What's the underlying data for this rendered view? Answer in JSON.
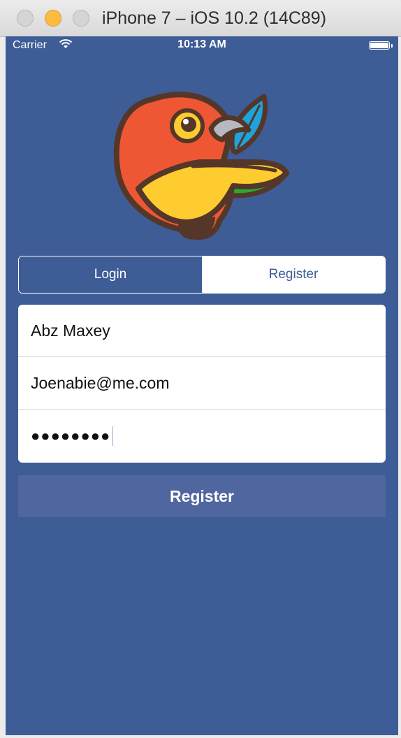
{
  "window": {
    "title": "iPhone 7 – iOS 10.2 (14C89)"
  },
  "status_bar": {
    "carrier": "Carrier",
    "time": "10:13 AM"
  },
  "segmented_control": {
    "login_label": "Login",
    "register_label": "Register",
    "selected": "Login"
  },
  "form": {
    "name_value": "Abz Maxey",
    "email_value": "Joenabie@me.com",
    "password_masked": "●●●●●●●●"
  },
  "register_button_label": "Register",
  "colors": {
    "background": "#3e5c96",
    "button": "#50669f",
    "field_background": "#ffffff",
    "bird_red": "#ef5734",
    "bird_yellow": "#ffcc2f",
    "bird_green": "#2baa33",
    "leaf_blue": "#1ea3dc",
    "outline": "#543729"
  },
  "icons": {
    "logo": "bower-bird-logo",
    "wifi": "wifi-icon",
    "battery": "battery-icon"
  }
}
